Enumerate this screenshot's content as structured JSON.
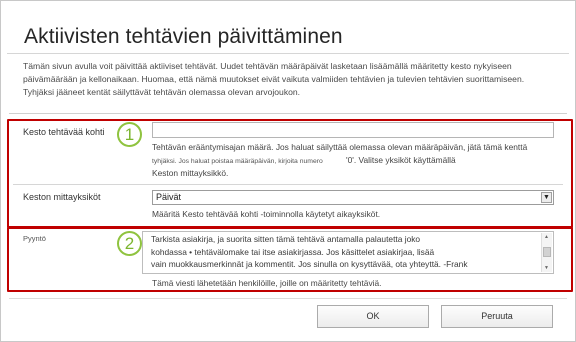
{
  "dialog": {
    "title": "Aktiivisten tehtävien päivittäminen",
    "intro_lines": [
      "Tämän sivun avulla voit päivittää aktiiviset tehtävät. Uudet tehtävän määräpäivät lasketaan lisäämällä määritetty kesto nykyiseen",
      "päivämäärään ja kellonaikaan. Huomaa, että nämä muutokset eivät vaikuta valmiiden tehtävien ja tulevien tehtävien suorittamiseen.",
      "Tyhjäksi jääneet kentät säilyttävät tehtävän olemassa olevan arvojoukon."
    ]
  },
  "duration_field": {
    "label": "Kesto tehtävää kohti",
    "value": "",
    "badge": "1",
    "help_line1": "Tehtävän erääntymisajan määrä. Jos haluat säilyttää olemassa olevan määräpäivän, jätä tämä kenttä",
    "help_line2_small": "tyhjäksi. Jos haluat poistaa määräpäivän, kirjoita numero",
    "help_line2_rest": "'0'. Valitse yksiköt käyttämällä",
    "help_line3": "Keston mittayksikkö."
  },
  "unit_field": {
    "label": "Keston mittayksiköt",
    "selected": "Päivät",
    "dropdown_glyph": "▼",
    "help": "Määritä Kesto tehtävää kohti -toiminnolla käytetyt aikayksiköt."
  },
  "request_field": {
    "label": "Pyyntö",
    "badge": "2",
    "text": "Tarkista asiakirja, ja suorita sitten tämä tehtävä antamalla palautetta joko\nkohdassa • tehtävälomake tai itse asiakirjassa. Jos käsittelet asiakirjaa, lisää\nvain muokkausmerkinnät ja kommentit. Jos sinulla on kysyttävää, ota yhteyttä. -Frank",
    "help": "Tämä viesti lähetetään henkilöille, joille on määritetty tehtäviä."
  },
  "buttons": {
    "ok": "OK",
    "cancel": "Peruuta"
  }
}
